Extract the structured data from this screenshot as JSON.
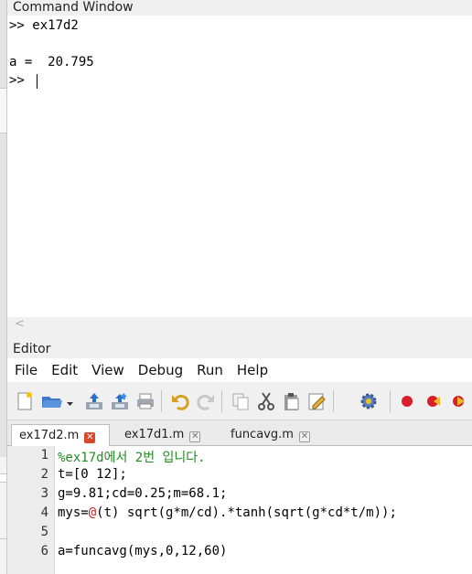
{
  "command_window": {
    "title": "Command Window",
    "lines": [
      ">> ex17d2",
      "",
      "a =  20.795",
      ">> "
    ],
    "scroll_arrow": "<"
  },
  "editor": {
    "title": "Editor",
    "menu": [
      "File",
      "Edit",
      "View",
      "Debug",
      "Run",
      "Help"
    ],
    "toolbar_icons": [
      "new-file-icon",
      "open-folder-icon",
      "dropdown-arrow-icon",
      "save-icon",
      "save-all-icon",
      "print-icon",
      "undo-icon",
      "redo-icon",
      "copy-icon",
      "cut-icon",
      "paste-icon",
      "edit-icon",
      "settings-icon",
      "breakpoint-icon",
      "step-back-icon",
      "run-icon"
    ],
    "tabs": [
      {
        "label": "ex17d2.m",
        "active": true
      },
      {
        "label": "ex17d1.m",
        "active": false
      },
      {
        "label": "funcavg.m",
        "active": false
      }
    ],
    "line_numbers": [
      "1",
      "2",
      "3",
      "4",
      "5",
      "6"
    ],
    "code": {
      "l1": "%ex17d에서 2번 입니다.",
      "l2": "t=[0 12];",
      "l3": "g=9.81;cd=0.25;m=68.1;",
      "l4_a": "mys=",
      "l4_b": "@",
      "l4_c": "(t) sqrt(g*m/cd).*tanh(sqrt(g*cd*t/m));",
      "l5": "",
      "l6": "a=funcavg(mys,0,12,60)"
    }
  },
  "colors": {
    "comment": "#228b22",
    "number": "#2a8a5a",
    "handle": "#c02020",
    "tab_close_active": "#d9472b"
  }
}
